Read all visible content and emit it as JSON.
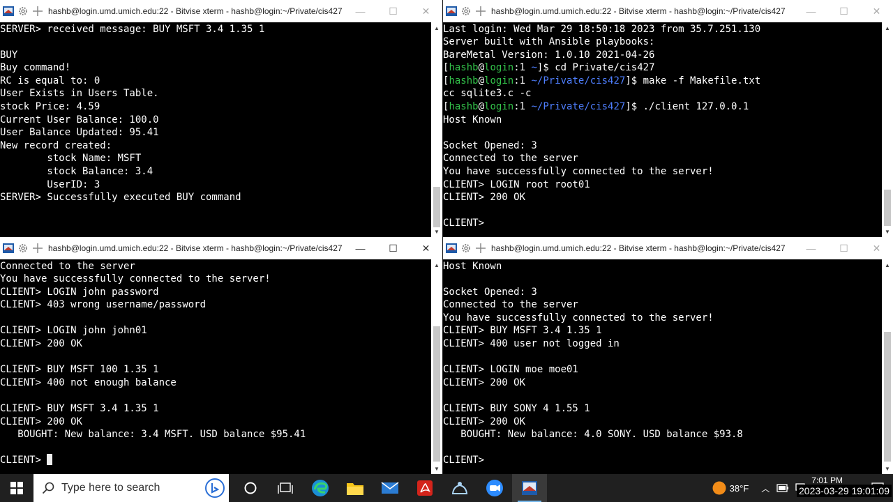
{
  "window_title": "hashb@login.umd.umich.edu:22 - Bitvise xterm - hashb@login:~/Private/cis427",
  "controls": {
    "minimize": "—",
    "maximize": "☐",
    "close": "✕"
  },
  "windows": {
    "tl": {
      "lines": [
        [
          {
            "t": "SERVER> received message: BUY MSFT 3.4 1.35 1"
          }
        ],
        [],
        [
          {
            "t": "BUY"
          }
        ],
        [
          {
            "t": "Buy command!"
          }
        ],
        [
          {
            "t": "RC is equal to: 0"
          }
        ],
        [
          {
            "t": "User Exists in Users Table."
          }
        ],
        [
          {
            "t": "stock Price: 4.59"
          }
        ],
        [
          {
            "t": "Current User Balance: 100.0"
          }
        ],
        [
          {
            "t": "User Balance Updated: 95.41"
          }
        ],
        [
          {
            "t": "New record created:"
          }
        ],
        [
          {
            "t": "        stock Name: MSFT"
          }
        ],
        [
          {
            "t": "        stock Balance: 3.4"
          }
        ],
        [
          {
            "t": "        UserID: 3"
          }
        ],
        [
          {
            "t": "SERVER> Successfully executed BUY command"
          }
        ]
      ]
    },
    "tr": {
      "lines": [
        [
          {
            "t": "Last login: Wed Mar 29 18:50:18 2023 from 35.7.251.130"
          }
        ],
        [
          {
            "t": "Server built with Ansible playbooks:"
          }
        ],
        [
          {
            "t": "BareMetal Version: 1.0.10 2021-04-26"
          }
        ],
        [
          {
            "t": "["
          },
          {
            "t": "hashb",
            "c": "green"
          },
          {
            "t": "@"
          },
          {
            "t": "login",
            "c": "green"
          },
          {
            "t": ":1 "
          },
          {
            "t": "~",
            "c": "blue"
          },
          {
            "t": "]$ cd Private/cis427"
          }
        ],
        [
          {
            "t": "["
          },
          {
            "t": "hashb",
            "c": "green"
          },
          {
            "t": "@"
          },
          {
            "t": "login",
            "c": "green"
          },
          {
            "t": ":1 "
          },
          {
            "t": "~/Private/cis427",
            "c": "blue"
          },
          {
            "t": "]$ make -f Makefile.txt"
          }
        ],
        [
          {
            "t": "cc sqlite3.c -c"
          }
        ],
        [
          {
            "t": "["
          },
          {
            "t": "hashb",
            "c": "green"
          },
          {
            "t": "@"
          },
          {
            "t": "login",
            "c": "green"
          },
          {
            "t": ":1 "
          },
          {
            "t": "~/Private/cis427",
            "c": "blue"
          },
          {
            "t": "]$ ./client 127.0.0.1"
          }
        ],
        [
          {
            "t": "Host Known"
          }
        ],
        [],
        [
          {
            "t": "Socket Opened: 3"
          }
        ],
        [
          {
            "t": "Connected to the server"
          }
        ],
        [
          {
            "t": "You have successfully connected to the server!"
          }
        ],
        [
          {
            "t": "CLIENT> LOGIN root root01"
          }
        ],
        [
          {
            "t": "CLIENT> 200 OK"
          }
        ],
        [],
        [
          {
            "t": "CLIENT>"
          }
        ]
      ]
    },
    "bl": {
      "lines": [
        [
          {
            "t": "Connected to the server"
          }
        ],
        [
          {
            "t": "You have successfully connected to the server!"
          }
        ],
        [
          {
            "t": "CLIENT> LOGIN john password"
          }
        ],
        [
          {
            "t": "CLIENT> 403 wrong username/password"
          }
        ],
        [],
        [
          {
            "t": "CLIENT> LOGIN john john01"
          }
        ],
        [
          {
            "t": "CLIENT> 200 OK"
          }
        ],
        [],
        [
          {
            "t": "CLIENT> BUY MSFT 100 1.35 1"
          }
        ],
        [
          {
            "t": "CLIENT> 400 not enough balance"
          }
        ],
        [],
        [
          {
            "t": "CLIENT> BUY MSFT 3.4 1.35 1"
          }
        ],
        [
          {
            "t": "CLIENT> 200 OK"
          }
        ],
        [
          {
            "t": "   BOUGHT: New balance: 3.4 MSFT. USD balance $95.41"
          }
        ],
        [],
        [
          {
            "t": "CLIENT> "
          },
          {
            "cursor": true
          }
        ]
      ]
    },
    "br": {
      "lines": [
        [
          {
            "t": "Host Known"
          }
        ],
        [],
        [
          {
            "t": "Socket Opened: 3"
          }
        ],
        [
          {
            "t": "Connected to the server"
          }
        ],
        [
          {
            "t": "You have successfully connected to the server!"
          }
        ],
        [
          {
            "t": "CLIENT> BUY MSFT 3.4 1.35 1"
          }
        ],
        [
          {
            "t": "CLIENT> 400 user not logged in"
          }
        ],
        [],
        [
          {
            "t": "CLIENT> LOGIN moe moe01"
          }
        ],
        [
          {
            "t": "CLIENT> 200 OK"
          }
        ],
        [],
        [
          {
            "t": "CLIENT> BUY SONY 4 1.55 1"
          }
        ],
        [
          {
            "t": "CLIENT> 200 OK"
          }
        ],
        [
          {
            "t": "   BOUGHT: New balance: 4.0 SONY. USD balance $93.8"
          }
        ],
        [],
        [
          {
            "t": "CLIENT>"
          }
        ]
      ]
    }
  },
  "taskbar": {
    "search_placeholder": "Type here to search",
    "apps": [
      "bing-icon",
      "cortana-icon",
      "task-view-icon",
      "edge-icon",
      "file-explorer-icon",
      "mail-icon",
      "acrobat-icon",
      "teams-icon",
      "zoom-icon",
      "bitvise-icon"
    ],
    "weather_temp": "38°F",
    "clock_time": "7:01 PM"
  },
  "timestamp_overlay": "2023-03-29 19:01:09",
  "colors": {
    "prompt_user": "#33c24a",
    "prompt_path": "#4f7fff"
  }
}
